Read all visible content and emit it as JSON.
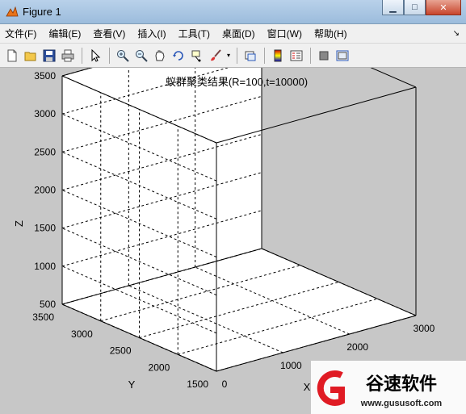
{
  "window": {
    "title": "Figure 1",
    "caption_buttons": [
      "minimize",
      "maximize",
      "close"
    ]
  },
  "menu": [
    "文件(F)",
    "编辑(E)",
    "查看(V)",
    "插入(I)",
    "工具(T)",
    "桌面(D)",
    "窗口(W)",
    "帮助(H)"
  ],
  "toolbar": {
    "buttons": [
      "new-figure-icon",
      "open-file-icon",
      "save-icon",
      "print-icon",
      "pointer-icon",
      "zoom-in-icon",
      "zoom-out-icon",
      "pan-icon",
      "rotate-3d-icon",
      "data-cursor-icon",
      "brush-icon",
      "link-plot-icon",
      "colorbar-icon",
      "legend-icon",
      "hide-plot-tools-icon",
      "show-plot-tools-icon"
    ]
  },
  "chart_data": {
    "type": "scatter",
    "title": "蚁群聚类结果(R=100,t=10000)",
    "xlabel": "X",
    "ylabel": "Y",
    "zlabel": "Z",
    "xlim": [
      0,
      3000
    ],
    "ylim": [
      1500,
      3500
    ],
    "zlim": [
      500,
      3500
    ],
    "x_ticks": [
      "0",
      "1000",
      "2000",
      "3000"
    ],
    "y_ticks": [
      "1500",
      "2000",
      "2500",
      "3000",
      "3500"
    ],
    "z_ticks": [
      "500",
      "1000",
      "1500",
      "2000",
      "2500",
      "3000",
      "3500"
    ],
    "grid": true,
    "series": [
      {
        "marker": "*",
        "color": "#ff0000",
        "values": []
      },
      {
        "marker": "o",
        "color": "#ff0000",
        "values": []
      },
      {
        "marker": "*",
        "color": "#00ff00",
        "values": []
      },
      {
        "marker": "+",
        "color": "#0000ff",
        "values": []
      },
      {
        "marker": "o",
        "color": "#0000ff",
        "values": []
      },
      {
        "marker": "s",
        "color": "#0000ff",
        "values": []
      }
    ]
  },
  "watermark": {
    "brand": "谷速软件",
    "url": "www.gususoft.com"
  }
}
